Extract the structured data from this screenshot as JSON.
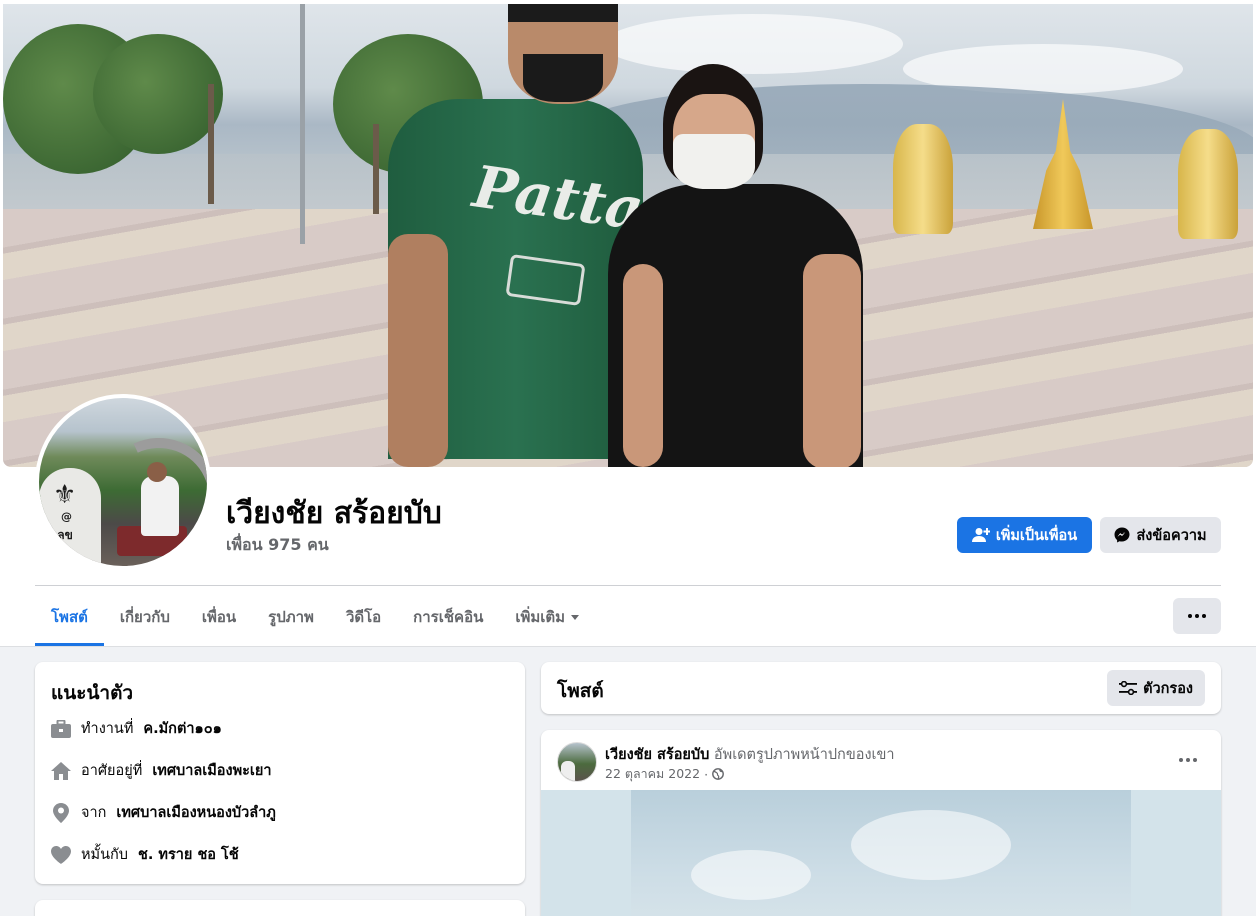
{
  "profile": {
    "name": "เวียงชัย สร้อยบับ",
    "friends_count": "เพื่อน 975 คน",
    "add_friend_label": "เพิ่มเป็นเพื่อน",
    "message_label": "ส่งข้อความ",
    "avatar_stone_line1": "@",
    "avatar_stone_line2": "นเลข"
  },
  "cover": {
    "shirt_logo": "Patta"
  },
  "tabs": [
    {
      "label": "โพสต์",
      "active": true
    },
    {
      "label": "เกี่ยวกับ"
    },
    {
      "label": "เพื่อน"
    },
    {
      "label": "รูปภาพ"
    },
    {
      "label": "วิดีโอ"
    },
    {
      "label": "การเช็คอิน"
    },
    {
      "label": "เพิ่มเติม"
    }
  ],
  "intro": {
    "title": "แนะนำตัว",
    "work": {
      "prefix": "ทำงานที่",
      "value": "ค.มักต่า๑๐๑"
    },
    "lives": {
      "prefix": "อาศัยอยู่ที่",
      "value": "เทศบาลเมืองพะเยา"
    },
    "from": {
      "prefix": "จาก",
      "value": "เทศบาลเมืองหนองบัวลำภู"
    },
    "relationship": {
      "prefix": "หมั้นกับ",
      "value": "ช. ทราย ชอ โช้"
    }
  },
  "posts": {
    "title": "โพสต์",
    "filter_label": "ตัวกรอง"
  },
  "post": {
    "author": "เวียงชัย สร้อยบับ",
    "action": "อัพเดตรูปภาพหน้าปกของเขา",
    "date": "22 ตุลาคม 2022",
    "separator": "·"
  },
  "colors": {
    "primary": "#1b74e4",
    "secondary_bg": "#e4e6eb",
    "page_bg": "#f0f2f5",
    "muted_text": "#65676b"
  },
  "icons": {
    "add_friend": "user-plus-icon",
    "message": "messenger-icon",
    "more": "more-dots-icon",
    "filter": "sliders-icon",
    "work": "briefcase-icon",
    "lives": "home-icon",
    "from": "location-pin-icon",
    "relationship": "heart-icon",
    "privacy": "globe-icon"
  }
}
